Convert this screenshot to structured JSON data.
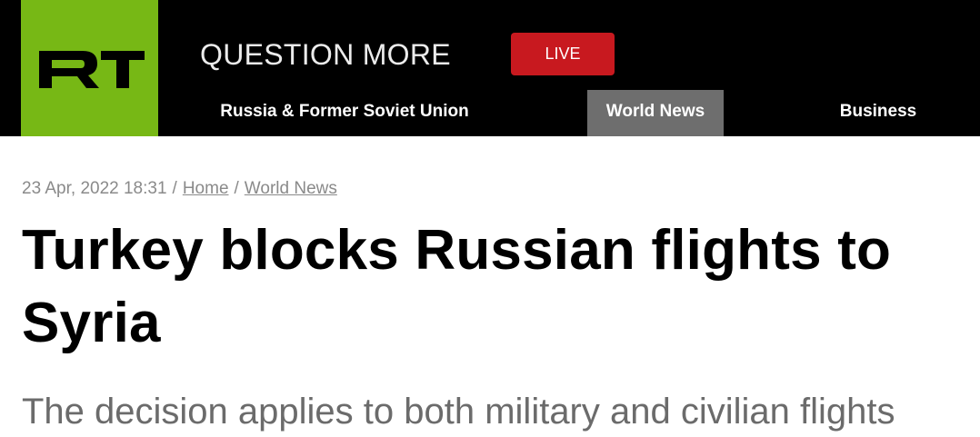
{
  "header": {
    "logo_text": "RT",
    "slogan": "QUESTION MORE",
    "live_label": "LIVE",
    "nav": [
      {
        "label": "Russia & Former Soviet Union",
        "active": false
      },
      {
        "label": "World News",
        "active": true
      },
      {
        "label": "Business",
        "active": false
      }
    ]
  },
  "article": {
    "date": "23 Apr, 2022 18:31",
    "breadcrumb": [
      "Home",
      "World News"
    ],
    "title": "Turkey blocks Russian flights to Syria",
    "summary": "The decision applies to both military and civilian flights"
  },
  "colors": {
    "brand_green": "#77b815",
    "live_red": "#c8191f",
    "header_bg": "#000000",
    "nav_active_bg": "#6e6e6e"
  }
}
